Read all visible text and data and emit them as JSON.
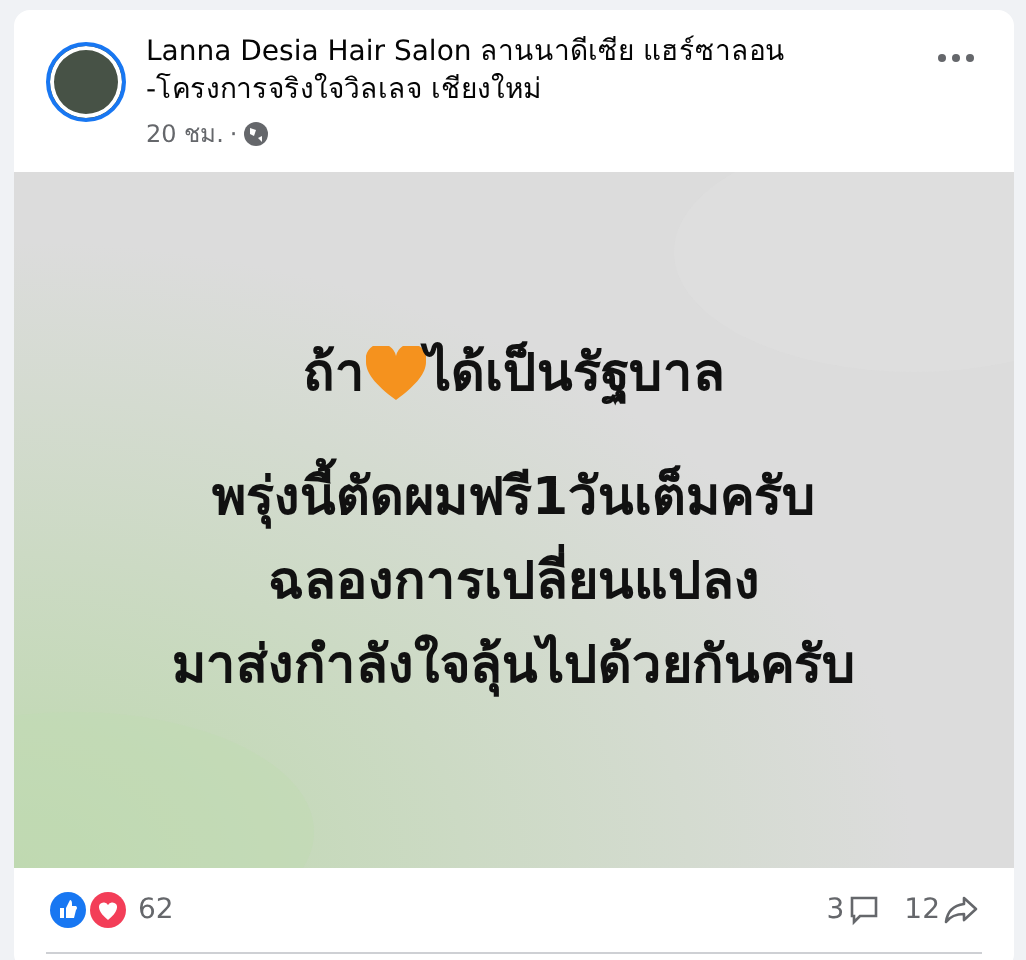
{
  "post": {
    "author": "Lanna Desia Hair Salon ลานนาดีเซีย แฮร์ซาลอน -โครงการจริงใจวิลเลจ เชียงใหม่",
    "time": "20 ชม.",
    "separator": "·"
  },
  "image_text": [
    [
      {
        "kind": "text",
        "text": "ถ้า"
      },
      {
        "kind": "heart"
      },
      {
        "kind": "text",
        "text": "ได้เป็นรัฐบาล"
      }
    ],
    [
      {
        "kind": "text",
        "text": "พรุ่งนี้ตัดผมฟรี1วันเต็มครับ"
      }
    ],
    [
      {
        "kind": "text",
        "text": "ฉลองการเปลี่ยนแปลง"
      }
    ],
    [
      {
        "kind": "text",
        "text": "มาส่งกำลังใจลุ้นไปด้วยกันครับ"
      }
    ]
  ],
  "footer": {
    "reactions": "62",
    "comments": "3",
    "shares": "12"
  }
}
